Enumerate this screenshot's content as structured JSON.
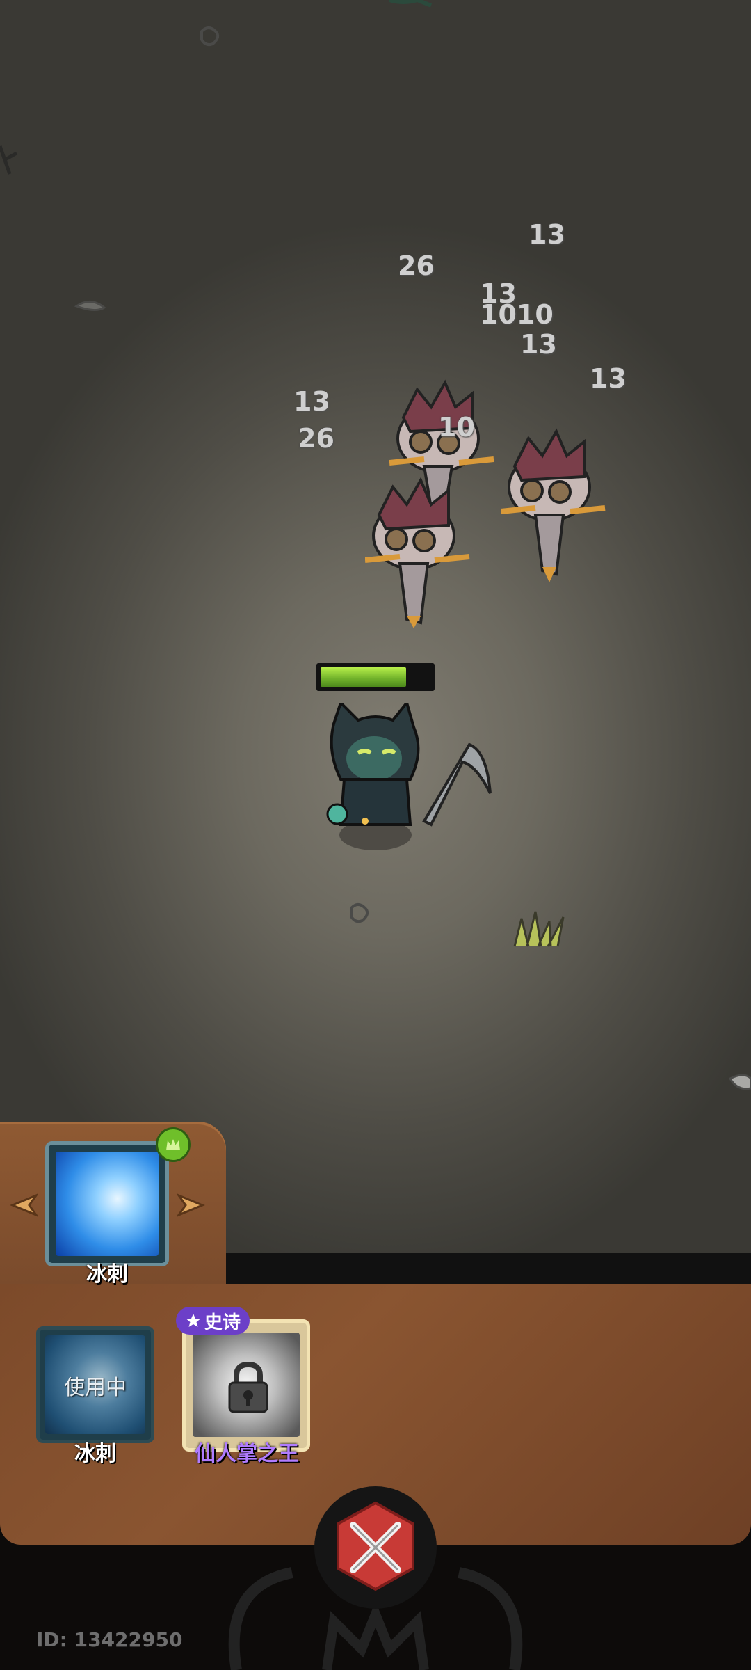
{
  "damage_numbers": [
    {
      "id": "d1",
      "text": "13"
    },
    {
      "id": "d2",
      "text": "26"
    },
    {
      "id": "d3",
      "text": "13"
    },
    {
      "id": "d4",
      "text": "1010"
    },
    {
      "id": "d5",
      "text": "10"
    },
    {
      "id": "d6",
      "text": "13"
    },
    {
      "id": "d7",
      "text": "13"
    },
    {
      "id": "d8",
      "text": "13"
    },
    {
      "id": "d9",
      "text": "26"
    },
    {
      "id": "d10",
      "text": "10"
    }
  ],
  "player": {
    "hp_fraction": 0.78,
    "hp_color": "#8fd43a"
  },
  "skill_panel": {
    "active_skill": {
      "name": "冰刺",
      "icon": "ice-spike-icon",
      "upgrade_icon": "crown-upgrade-icon"
    },
    "slots": [
      {
        "name": "冰刺",
        "status": "使用中",
        "icon": "ice-spike-icon"
      },
      {
        "name": "仙人掌之王",
        "rarity": "史诗",
        "icon": "lock-icon",
        "name_color": "#b07cff"
      }
    ]
  },
  "close_button": {
    "icon": "crossed-swords-close-icon"
  },
  "footer": {
    "id_text": "ID: 13422950"
  }
}
